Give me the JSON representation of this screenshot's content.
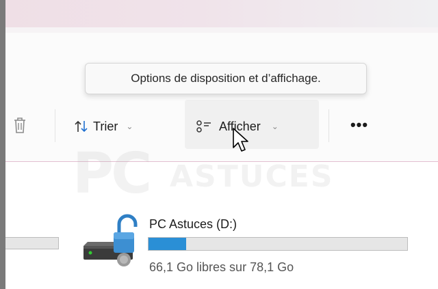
{
  "tooltip": {
    "text": "Options de disposition et d’affichage."
  },
  "toolbar": {
    "delete_icon": "trash-icon",
    "sort": {
      "label": "Trier",
      "icon": "sort-arrows-icon"
    },
    "view": {
      "label": "Afficher",
      "icon": "layout-list-icon"
    },
    "more": {
      "label": "•••"
    }
  },
  "drive": {
    "name": "PC Astuces (D:)",
    "space_text": "66,1 Go libres sur 78,1 Go",
    "used_fraction": 0.146,
    "icon": "locked-drive-icon"
  },
  "colors": {
    "accent": "#2a8fd6",
    "lock": "#3d8fd2",
    "titlebar": "#efdfe6"
  }
}
